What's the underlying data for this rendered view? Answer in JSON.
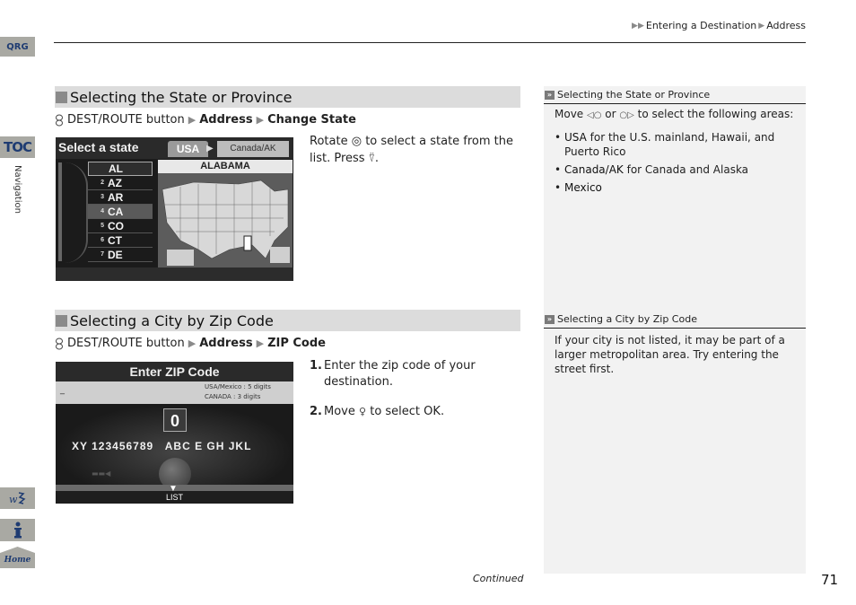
{
  "side_tabs": {
    "qrg": "QRG",
    "toc": "TOC",
    "section_label": "Navigation",
    "voice_icon": "voice-command-icon",
    "info_icon": "info-icon",
    "home": "Home"
  },
  "breadcrumb": {
    "items": [
      "Entering a Destination",
      "Address"
    ]
  },
  "sections": [
    {
      "heading": "Selecting the State or Province",
      "path": {
        "prefix": "DEST/ROUTE button",
        "steps": [
          "Address",
          "Change State"
        ]
      },
      "instruction": {
        "part1": "Rotate",
        "part2": "to select a state from the list. Press",
        "part3": "."
      },
      "screen": {
        "title": "Select a state",
        "tabs": [
          "USA",
          "Canada/AK"
        ],
        "selected_state_name": "ALABAMA",
        "states": [
          {
            "num": "",
            "code": "AL"
          },
          {
            "num": "2",
            "code": "AZ"
          },
          {
            "num": "3",
            "code": "AR"
          },
          {
            "num": "4",
            "code": "CA"
          },
          {
            "num": "5",
            "code": "CO"
          },
          {
            "num": "6",
            "code": "CT"
          },
          {
            "num": "7",
            "code": "DE"
          }
        ]
      },
      "note": {
        "heading": "Selecting the State or Province",
        "intro_a": "Move",
        "intro_b": "or",
        "intro_c": "to select the following areas:",
        "items": [
          {
            "bold": "USA",
            "text": " for the U.S. mainland, Hawaii, and Puerto Rico"
          },
          {
            "bold": "Canada/AK",
            "text": " for Canada and Alaska"
          },
          {
            "bold": "Mexico",
            "text": ""
          }
        ]
      }
    },
    {
      "heading": "Selecting a City by Zip Code",
      "path": {
        "prefix": "DEST/ROUTE button",
        "steps": [
          "Address",
          "ZIP Code"
        ]
      },
      "steps": [
        {
          "num": "1.",
          "text": "Enter the zip code of your destination."
        },
        {
          "num": "2.",
          "text_a": "Move",
          "text_b": "to select",
          "bold": "OK",
          "text_c": "."
        }
      ],
      "screen": {
        "title": "Enter ZIP Code",
        "input_value": "_",
        "hint1": "USA/Mexico : 5 digits",
        "hint2": "CANADA : 3 digits",
        "selected_char": "0",
        "keyboard_row": "XY 123456789   ABC E GH JKL",
        "list_label": "LIST"
      },
      "note": {
        "heading": "Selecting a City by Zip Code",
        "text": "If your city is not listed, it may be part of a larger metropolitan area. Try entering the street first."
      }
    }
  ],
  "footer": {
    "continued": "Continued",
    "page_number": "71"
  }
}
